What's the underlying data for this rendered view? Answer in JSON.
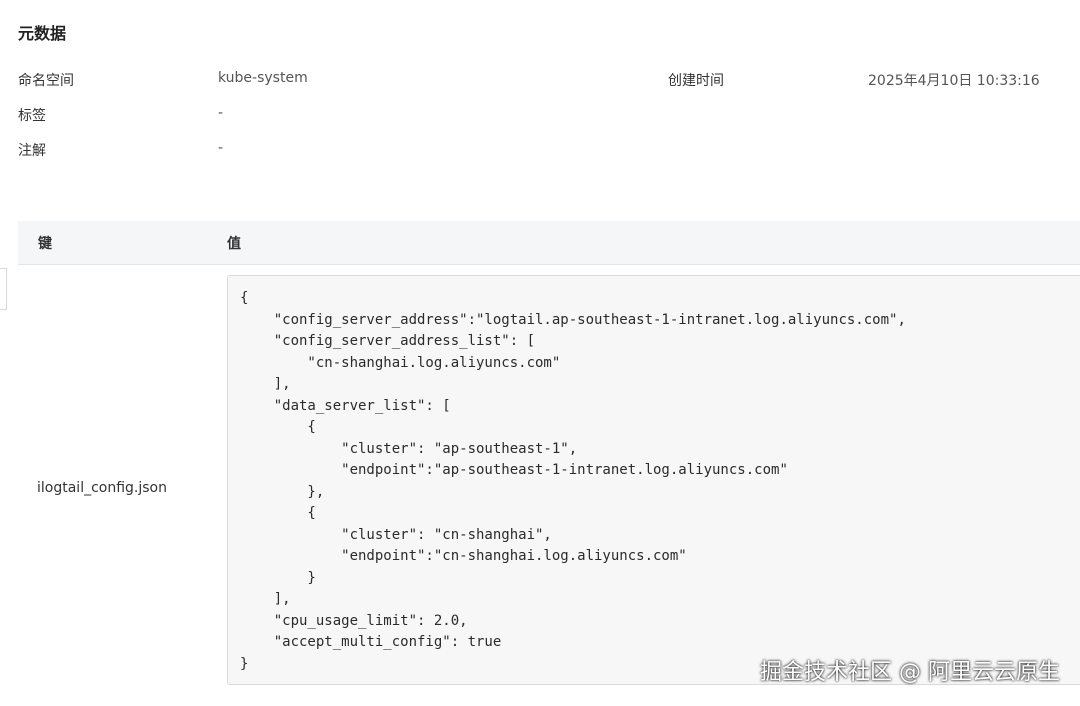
{
  "metadata": {
    "title": "元数据",
    "namespace_label": "命名空间",
    "namespace_value": "kube-system",
    "created_label": "创建时间",
    "created_value": "2025年4月10日 10:33:16",
    "labels_label": "标签",
    "labels_value": "-",
    "annotations_label": "注解",
    "annotations_value": "-"
  },
  "kv_table": {
    "key_header": "键",
    "value_header": "值",
    "rows": [
      {
        "key": "ilogtail_config.json",
        "value": "{\n    \"config_server_address\":\"logtail.ap-southeast-1-intranet.log.aliyuncs.com\",\n    \"config_server_address_list\": [\n        \"cn-shanghai.log.aliyuncs.com\"\n    ],\n    \"data_server_list\": [\n        {\n            \"cluster\": \"ap-southeast-1\",\n            \"endpoint\":\"ap-southeast-1-intranet.log.aliyuncs.com\"\n        },\n        {\n            \"cluster\": \"cn-shanghai\",\n            \"endpoint\":\"cn-shanghai.log.aliyuncs.com\"\n        }\n    ],\n    \"cpu_usage_limit\": 2.0,\n    \"accept_multi_config\": true\n}"
      }
    ]
  },
  "watermark": "掘金技术社区 @ 阿里云云原生"
}
